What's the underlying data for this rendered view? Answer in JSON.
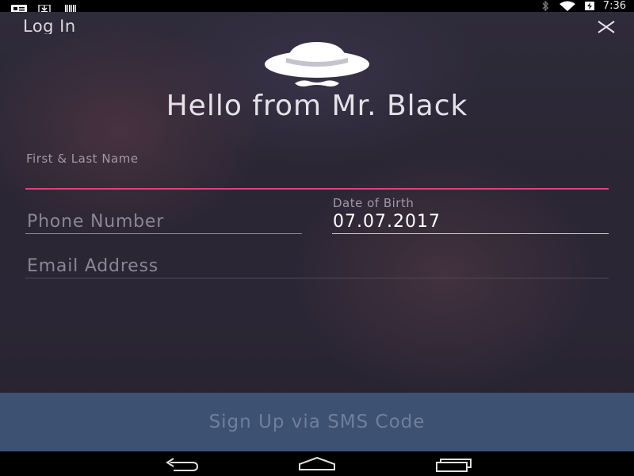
{
  "status_bar": {
    "left_icons": [
      "notification-card-icon",
      "download-icon",
      "barcode-icon"
    ],
    "right_icons": [
      "bluetooth-icon",
      "wifi-icon",
      "battery-charging-icon"
    ],
    "time": "7:36"
  },
  "header": {
    "login_label": "Log In",
    "close_icon": "close-icon"
  },
  "logo": {
    "icon": "mr-black-hat-mustache-logo"
  },
  "headline": "Hello from Mr. Black",
  "form": {
    "name": {
      "label": "First & Last Name",
      "value": ""
    },
    "phone": {
      "placeholder": "Phone Number",
      "value": ""
    },
    "dob": {
      "label": "Date of Birth",
      "value": "07.07.2017"
    },
    "email": {
      "placeholder": "Email Address",
      "value": ""
    }
  },
  "signup_button": {
    "label": "Sign Up via SMS Code"
  },
  "nav_bar": {
    "icons": [
      "back-icon",
      "home-icon",
      "recent-apps-icon"
    ]
  },
  "colors": {
    "accent_underline": "#e0417a",
    "button_bg": "#3d5173",
    "button_text": "#6f7f9c"
  }
}
